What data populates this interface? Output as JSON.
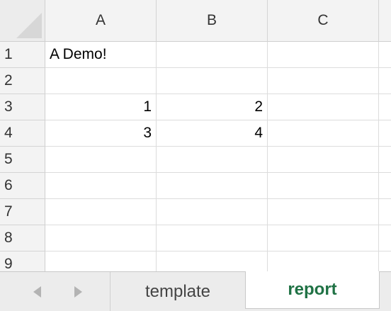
{
  "columns": [
    "A",
    "B",
    "C"
  ],
  "rows": [
    "1",
    "2",
    "3",
    "4",
    "5",
    "6",
    "7",
    "8",
    "9"
  ],
  "cells": {
    "A1": "A Demo!",
    "A3": "1",
    "B3": "2",
    "A4": "3",
    "B4": "4"
  },
  "sheet_tabs": [
    "template",
    "report"
  ],
  "active_sheet": "report",
  "colors": {
    "active_tab_text": "#207245"
  }
}
